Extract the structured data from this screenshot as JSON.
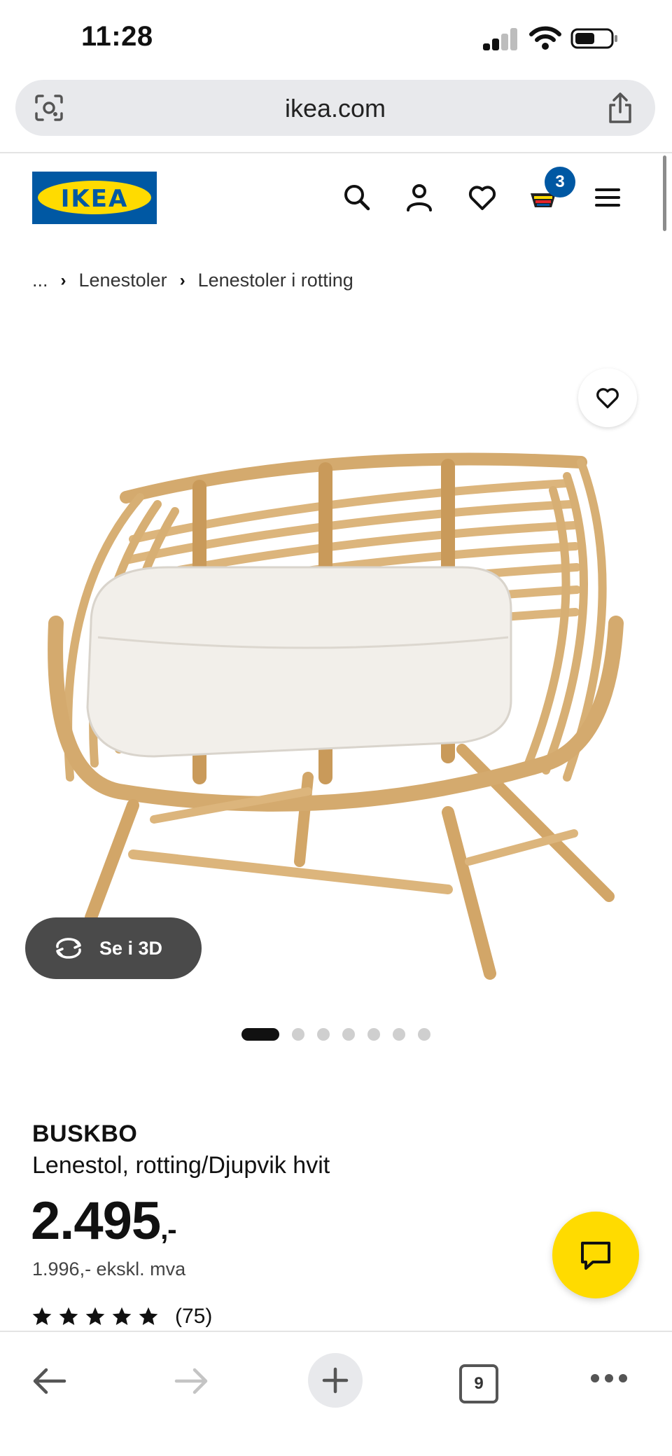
{
  "status_bar": {
    "time": "11:28"
  },
  "browser": {
    "url": "ikea.com",
    "tabs_count": "9"
  },
  "header": {
    "logo_text": "IKEA",
    "cart_count": "3"
  },
  "breadcrumb": [
    "...",
    "Lenestoler",
    "Lenestoler i rotting"
  ],
  "gallery": {
    "view_3d_label": "Se i 3D",
    "total_images": 7,
    "active_index": 0
  },
  "product": {
    "name": "BUSKBO",
    "description": "Lenestol, rotting/Djupvik hvit",
    "price": "2.495",
    "price_suffix": ",-",
    "price_ex_vat": "1.996,- ekskl. mva",
    "rating_stars": 5,
    "rating_count": "(75)"
  },
  "colors": {
    "ikea_blue": "#0058a3",
    "ikea_yellow": "#ffdb00",
    "rattan": "#d9b27a"
  }
}
